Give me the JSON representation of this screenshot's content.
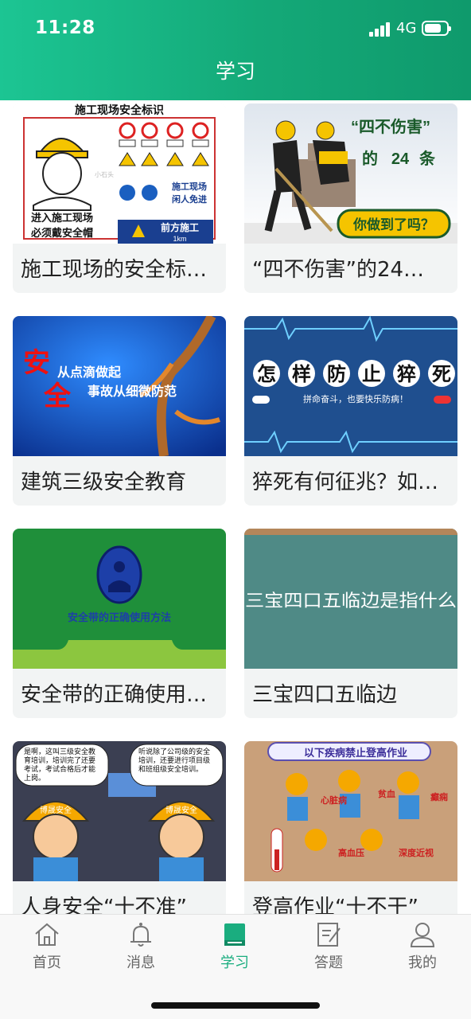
{
  "status": {
    "time": "11:28",
    "network": "4G"
  },
  "header": {
    "title": "学习"
  },
  "cards": [
    {
      "title": "施工现场的安全标…",
      "thumb_lines": [
        "施工现场安全标识",
        "进入施工现场",
        "必须戴安全帽",
        "施工现场",
        "闲人免进",
        "前方施工",
        "1km",
        "小石头"
      ]
    },
    {
      "title": "“四不伤害”的24…",
      "thumb_lines": [
        "“四不伤害”",
        "的",
        "24",
        "条",
        "你做到了吗？"
      ]
    },
    {
      "title": "建筑三级安全教育",
      "thumb_lines": [
        "安",
        "全",
        "从点滴做起",
        "事故从细微防范"
      ]
    },
    {
      "title": "猝死有何征兆？如…",
      "thumb_lines": [
        "怎",
        "样",
        "防",
        "止",
        "猝",
        "死",
        "拼命奋斗，也要快乐防病！"
      ]
    },
    {
      "title": "安全带的正确使用…",
      "thumb_lines": [
        "安全带的正确使用方法"
      ]
    },
    {
      "title": "三宝四口五临边",
      "thumb_lines": [
        "三宝四口五临边是指什么"
      ]
    },
    {
      "title": "人身安全“十不准”",
      "thumb_lines": [
        "是啊，这叫三级安全教育培训，培训完了还要考试，考试合格后才能上岗。",
        "听说除了公司级的安全培训，还要进行项目级和班组级安全培训。",
        "博晟安全",
        "博晟安全"
      ]
    },
    {
      "title": "登高作业“十不干”",
      "thumb_lines": [
        "以下疾病禁止登高作业",
        "心脏病",
        "贫血",
        "癫痫",
        "高血压",
        "深度近视"
      ]
    }
  ],
  "tabs": [
    {
      "label": "首页",
      "icon": "house-icon",
      "active": false
    },
    {
      "label": "消息",
      "icon": "bell-icon",
      "active": false
    },
    {
      "label": "学习",
      "icon": "book-icon",
      "active": true
    },
    {
      "label": "答题",
      "icon": "edit-paper-icon",
      "active": false
    },
    {
      "label": "我的",
      "icon": "user-icon",
      "active": false
    }
  ],
  "colors": {
    "primary": "#1aad7f",
    "header_start": "#1cc593",
    "header_end": "#0f9a6c",
    "tab_inactive": "#666666"
  }
}
